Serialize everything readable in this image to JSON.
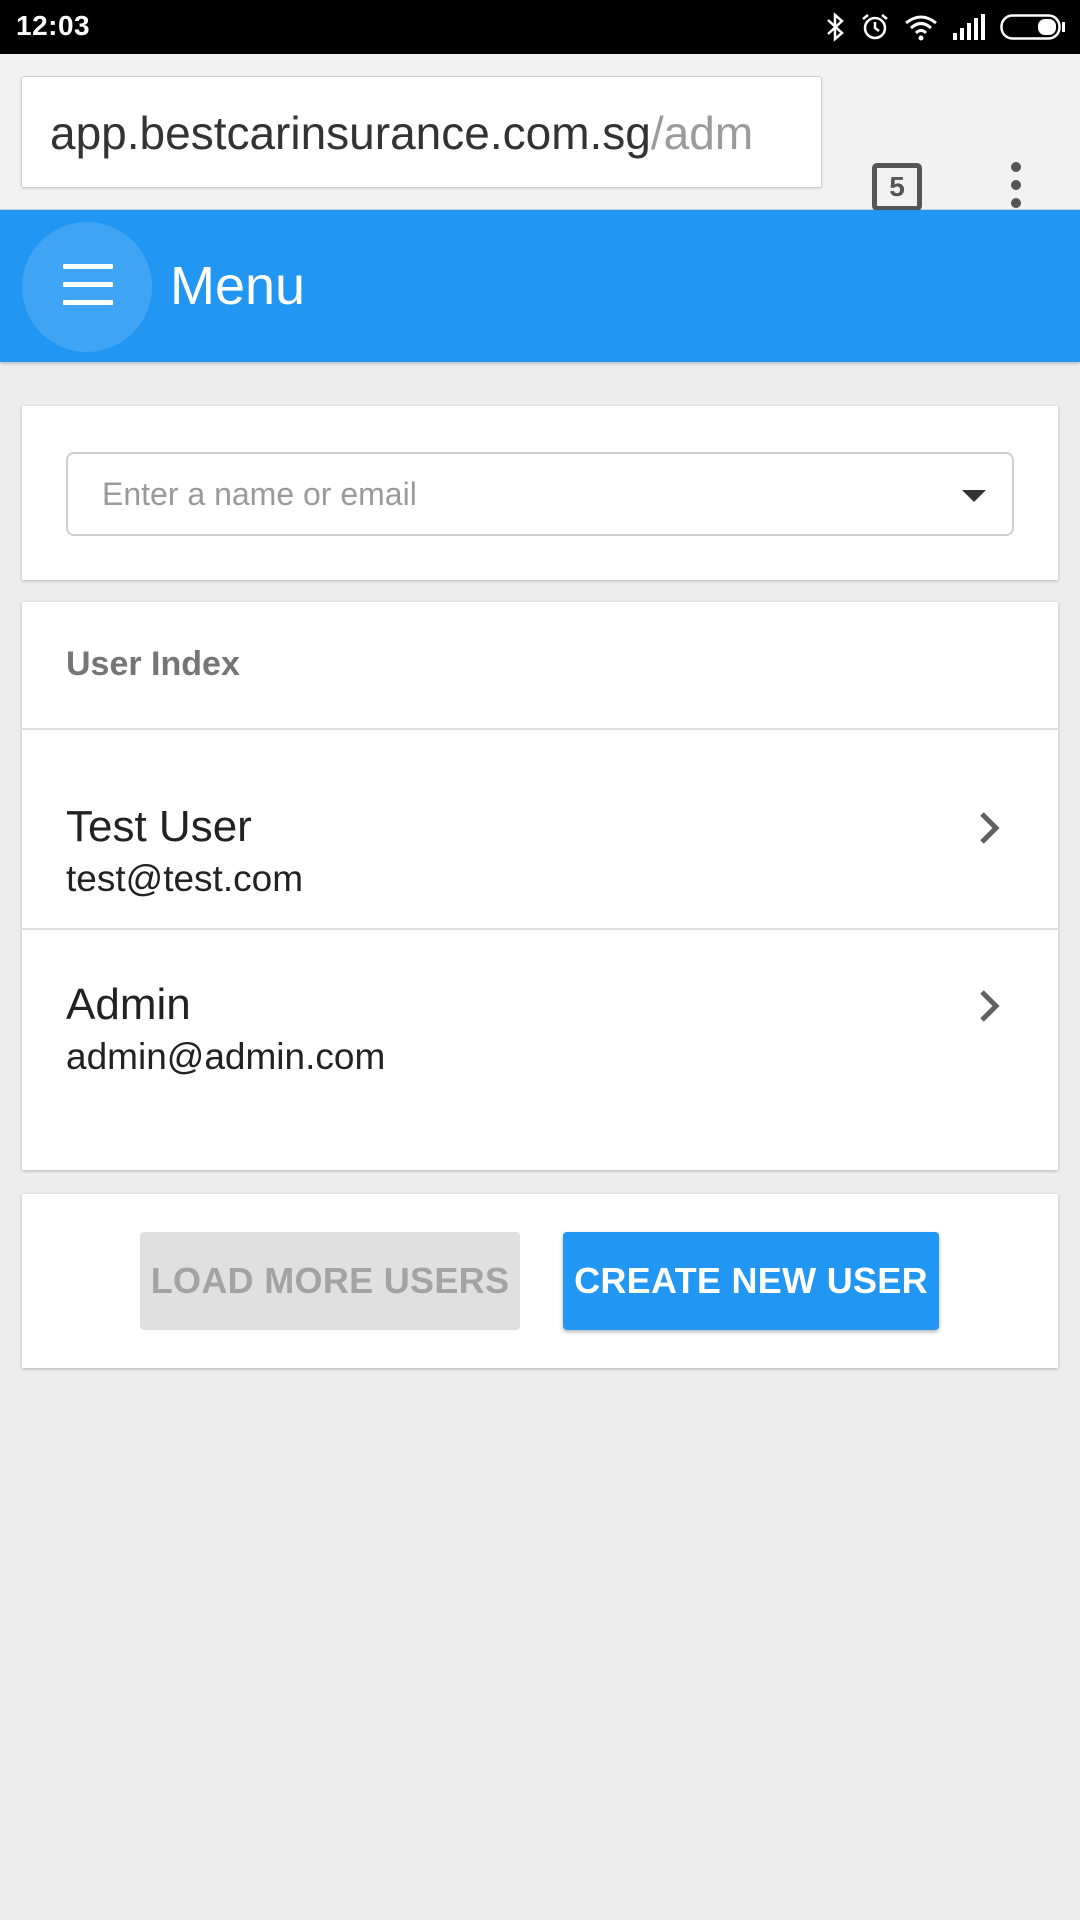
{
  "status_bar": {
    "time": "12:03",
    "icons": [
      "bluetooth-icon",
      "alarm-icon",
      "wifi-icon",
      "signal-icon",
      "battery-icon"
    ]
  },
  "browser": {
    "url_host": "app.bestcarinsurance.com.sg",
    "url_path": "/adm",
    "tab_count": "5"
  },
  "header": {
    "title": "Menu",
    "color": "#2196f3"
  },
  "search": {
    "placeholder": "Enter a name or email",
    "value": ""
  },
  "users": {
    "heading": "User Index",
    "items": [
      {
        "name": "Test User",
        "email": "test@test.com"
      },
      {
        "name": "Admin",
        "email": "admin@admin.com"
      }
    ]
  },
  "actions": {
    "load_more_label": "LOAD MORE USERS",
    "create_label": "CREATE NEW USER"
  }
}
